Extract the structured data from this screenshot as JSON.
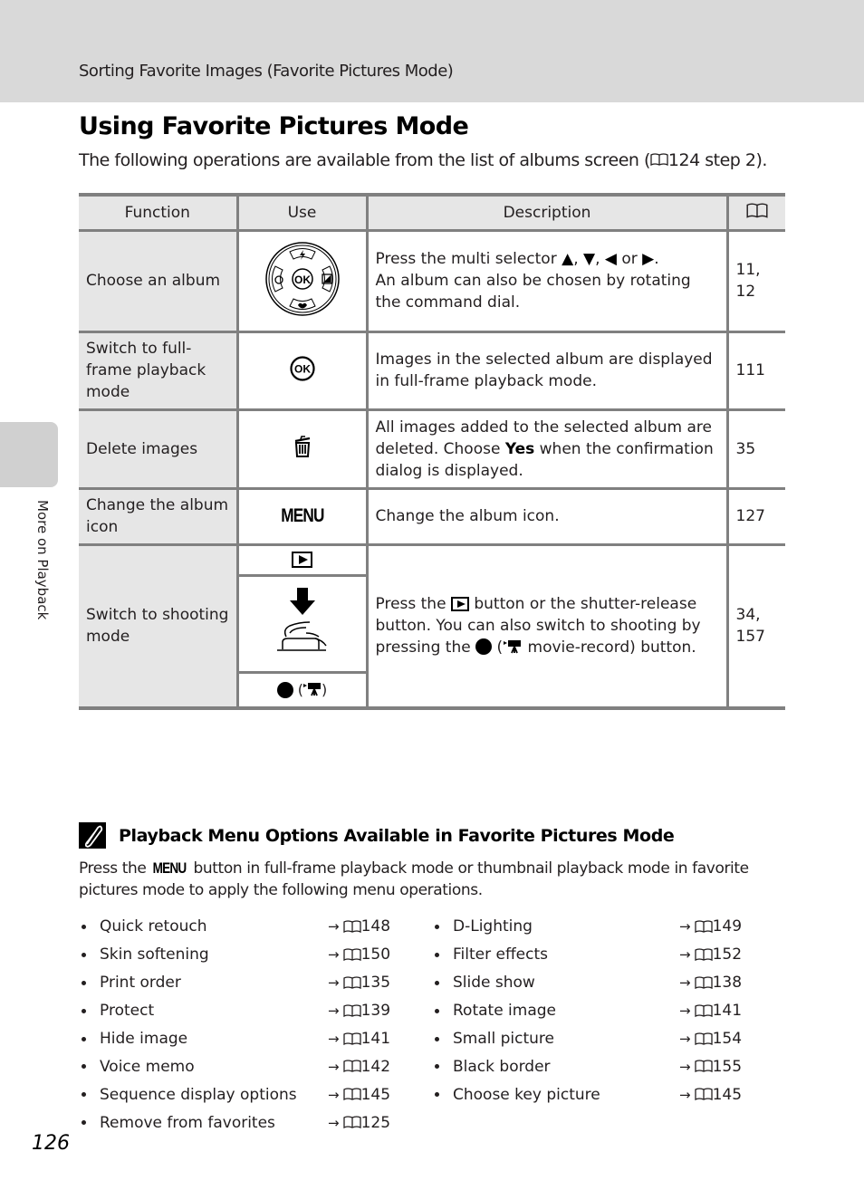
{
  "header": {
    "breadcrumb": "Sorting Favorite Images (Favorite Pictures Mode)"
  },
  "side_tab": {
    "label": "More on Playback"
  },
  "page": {
    "title": "Using Favorite Pictures Mode",
    "intro_before": "The following operations are available from the list of albums screen (",
    "intro_ref": "124 step 2).",
    "number": "126"
  },
  "table": {
    "headers": {
      "function": "Function",
      "use": "Use",
      "description": "Description",
      "reference_icon": "book-icon"
    },
    "rows": [
      {
        "function": "Choose an album",
        "use_icon": "multi-selector-icon",
        "description_parts": [
          "Press the multi selector ",
          "▲",
          ", ",
          "▼",
          ", ",
          "◀",
          " or ",
          "▶",
          "."
        ],
        "description_line2": "An album can also be chosen by rotating the command dial.",
        "ref": "11,\n12"
      },
      {
        "function": "Switch to full-frame playback mode",
        "use_icon": "ok-button-icon",
        "description": "Images in the selected album are displayed in full-frame playback mode.",
        "ref": "111"
      },
      {
        "function": "Delete images",
        "use_icon": "trash-icon",
        "description_before": "All images added to the selected album are deleted. Choose ",
        "description_bold": "Yes",
        "description_after": " when the confirmation dialog is displayed.",
        "ref": "35"
      },
      {
        "function": "Change the album icon",
        "use_icon": "menu-button-icon",
        "use_text": "MENU",
        "description": "Change the album icon.",
        "ref": "127"
      },
      {
        "function": "Switch to shooting mode",
        "use_icons": [
          "playback-button-icon",
          "shutter-release-icon",
          "movie-record-button-icon"
        ],
        "description_p1": "Press the ",
        "description_p2": " button or the shutter-release button. You can also switch to shooting by pressing the ",
        "description_p3": " (",
        "description_p4": " movie-record) button.",
        "ref": "34,\n157"
      }
    ]
  },
  "note": {
    "icon": "pencil-note-icon",
    "title": "Playback Menu Options Available in Favorite Pictures Mode",
    "text_before": "Press the ",
    "menu_label": "MENU",
    "text_after": " button in full-frame playback mode or thumbnail playback mode in favorite pictures mode to apply the following menu operations.",
    "left_items": [
      {
        "label": "Quick retouch",
        "ref": "148"
      },
      {
        "label": "Skin softening",
        "ref": "150"
      },
      {
        "label": "Print order",
        "ref": "135"
      },
      {
        "label": "Protect",
        "ref": "139"
      },
      {
        "label": "Hide image",
        "ref": "141"
      },
      {
        "label": "Voice memo",
        "ref": "142"
      },
      {
        "label": "Sequence display options",
        "ref": "145"
      },
      {
        "label": "Remove from favorites",
        "ref": "125"
      }
    ],
    "right_items": [
      {
        "label": "D-Lighting",
        "ref": "149"
      },
      {
        "label": "Filter effects",
        "ref": "152"
      },
      {
        "label": "Slide show",
        "ref": "138"
      },
      {
        "label": "Rotate image",
        "ref": "141"
      },
      {
        "label": "Small picture",
        "ref": "154"
      },
      {
        "label": "Black border",
        "ref": "155"
      },
      {
        "label": "Choose key picture",
        "ref": "145"
      }
    ],
    "arrow": "→"
  }
}
